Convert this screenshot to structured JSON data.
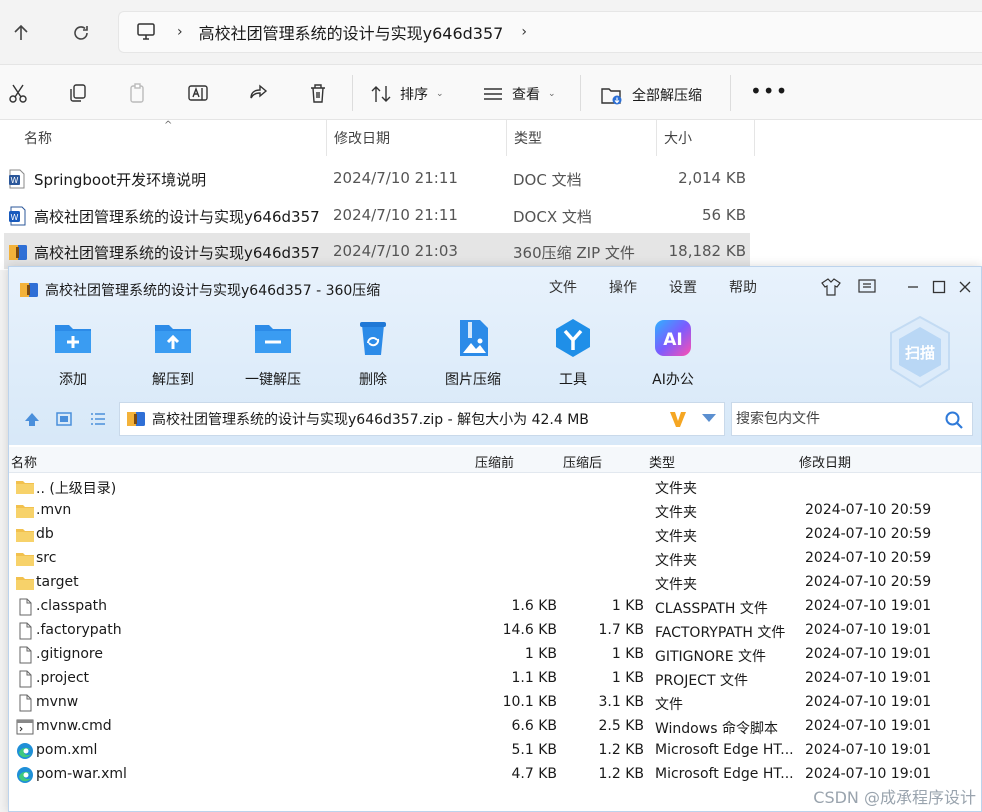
{
  "explorer": {
    "path": "高校社团管理系统的设计与实现y646d357",
    "toolbar": {
      "sort_label": "排序",
      "view_label": "查看",
      "extract_all_label": "全部解压缩"
    },
    "columns": {
      "name": "名称",
      "date": "修改日期",
      "type": "类型",
      "size": "大小"
    },
    "files": [
      {
        "name": "Springboot开发环境说明",
        "date": "2024/7/10 21:11",
        "type": "DOC 文档",
        "size": "2,014 KB",
        "icon": "word-doc-icon"
      },
      {
        "name": "高校社团管理系统的设计与实现y646d357",
        "date": "2024/7/10 21:11",
        "type": "DOCX 文档",
        "size": "56 KB",
        "icon": "word-docx-icon"
      },
      {
        "name": "高校社团管理系统的设计与实现y646d357",
        "date": "2024/7/10 21:03",
        "type": "360压缩 ZIP 文件",
        "size": "18,182 KB",
        "icon": "zip-archive-icon",
        "selected": true
      }
    ]
  },
  "archiver": {
    "title": "高校社团管理系统的设计与实现y646d357 - 360压缩",
    "menu": [
      "文件",
      "操作",
      "设置",
      "帮助"
    ],
    "tools": [
      "添加",
      "解压到",
      "一键解压",
      "删除",
      "图片压缩",
      "工具",
      "AI办公"
    ],
    "ai_badge": "AI",
    "scan_label": "扫描",
    "path_text": "高校社团管理系统的设计与实现y646d357.zip - 解包大小为 42.4 MB",
    "search_placeholder": "搜索包内文件",
    "columns": {
      "name": "名称",
      "before": "压缩前",
      "after": "压缩后",
      "type": "类型",
      "date": "修改日期"
    },
    "entries": [
      {
        "name": ".. (上级目录)",
        "before": "",
        "after": "",
        "type": "文件夹",
        "date": "",
        "icon": "folder-icon"
      },
      {
        "name": ".mvn",
        "before": "",
        "after": "",
        "type": "文件夹",
        "date": "2024-07-10 20:59",
        "icon": "folder-icon"
      },
      {
        "name": "db",
        "before": "",
        "after": "",
        "type": "文件夹",
        "date": "2024-07-10 20:59",
        "icon": "folder-icon"
      },
      {
        "name": "src",
        "before": "",
        "after": "",
        "type": "文件夹",
        "date": "2024-07-10 20:59",
        "icon": "folder-icon"
      },
      {
        "name": "target",
        "before": "",
        "after": "",
        "type": "文件夹",
        "date": "2024-07-10 20:59",
        "icon": "folder-icon"
      },
      {
        "name": ".classpath",
        "before": "1.6 KB",
        "after": "1 KB",
        "type": "CLASSPATH 文件",
        "date": "2024-07-10 19:01",
        "icon": "file-icon"
      },
      {
        "name": ".factorypath",
        "before": "14.6 KB",
        "after": "1.7 KB",
        "type": "FACTORYPATH 文件",
        "date": "2024-07-10 19:01",
        "icon": "file-icon"
      },
      {
        "name": ".gitignore",
        "before": "1 KB",
        "after": "1 KB",
        "type": "GITIGNORE 文件",
        "date": "2024-07-10 19:01",
        "icon": "file-icon"
      },
      {
        "name": ".project",
        "before": "1.1 KB",
        "after": "1 KB",
        "type": "PROJECT 文件",
        "date": "2024-07-10 19:01",
        "icon": "file-icon"
      },
      {
        "name": "mvnw",
        "before": "10.1 KB",
        "after": "3.1 KB",
        "type": "文件",
        "date": "2024-07-10 19:01",
        "icon": "file-icon"
      },
      {
        "name": "mvnw.cmd",
        "before": "6.6 KB",
        "after": "2.5 KB",
        "type": "Windows 命令脚本",
        "date": "2024-07-10 19:01",
        "icon": "cmd-script-icon"
      },
      {
        "name": "pom.xml",
        "before": "5.1 KB",
        "after": "1.2 KB",
        "type": "Microsoft Edge HT...",
        "date": "2024-07-10 19:01",
        "icon": "edge-icon"
      },
      {
        "name": "pom-war.xml",
        "before": "4.7 KB",
        "after": "1.2 KB",
        "type": "Microsoft Edge HT...",
        "date": "2024-07-10 19:01",
        "icon": "edge-icon"
      }
    ]
  },
  "watermark": "CSDN @成承程序设计"
}
